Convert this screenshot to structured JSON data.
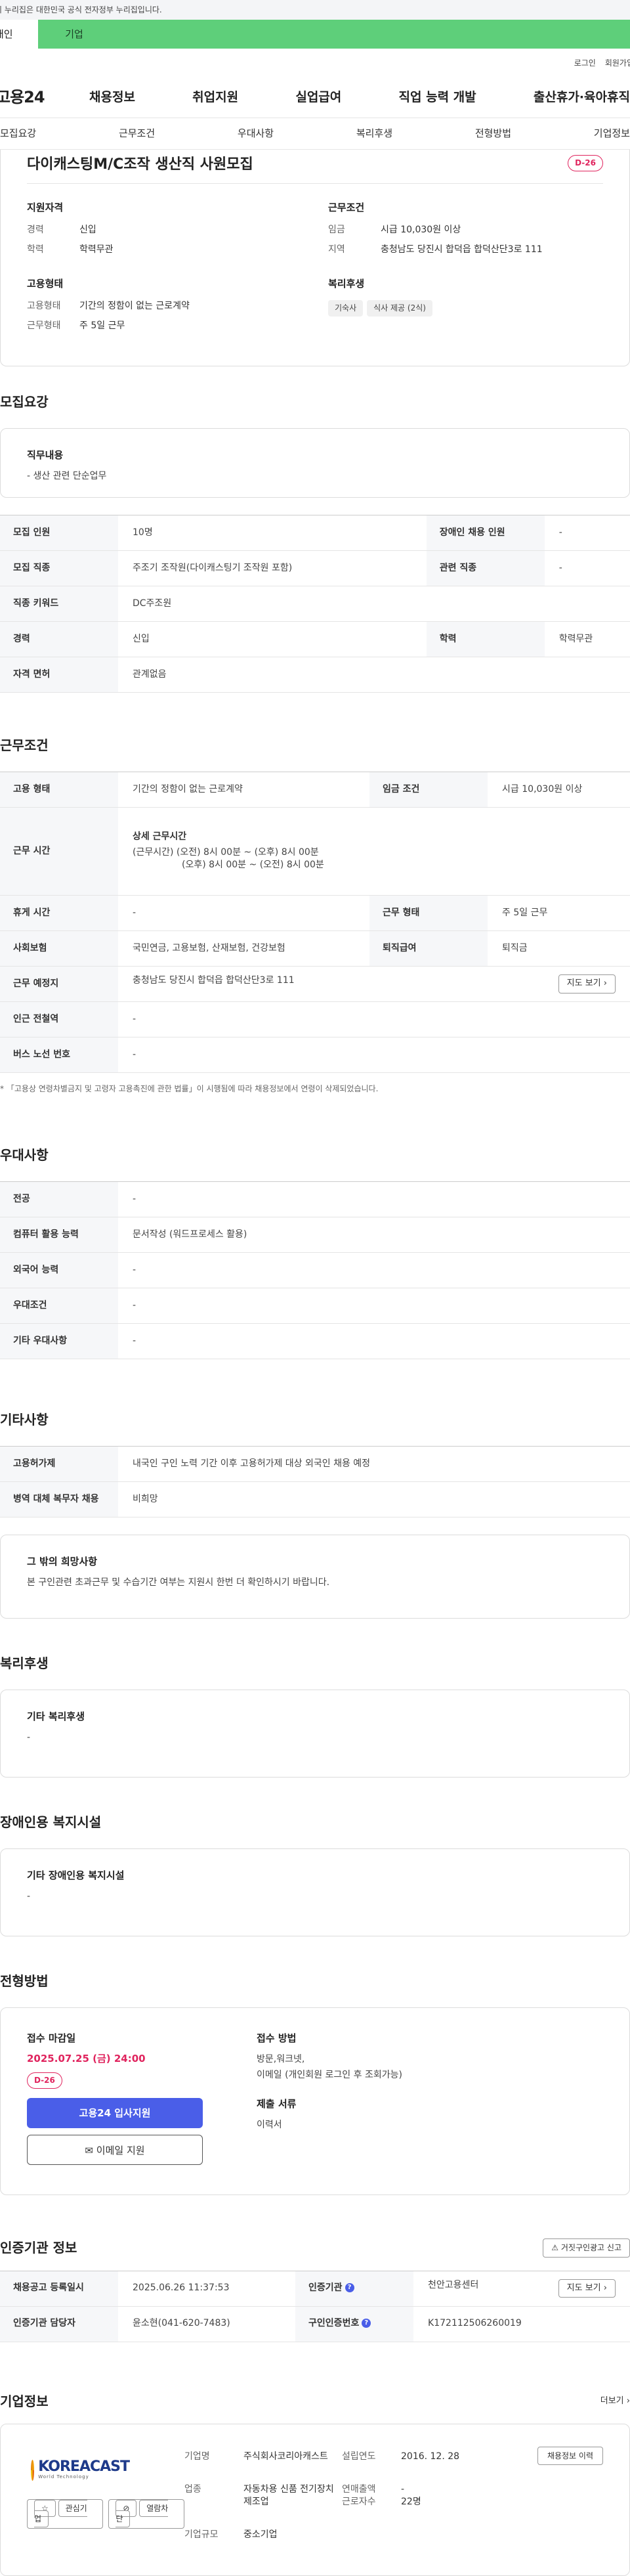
{
  "gov_notice": "이 누리집은 대한민국 공식 전자정부 누리집입니다.",
  "top_tabs": {
    "personal": "개인",
    "company": "기업"
  },
  "util": {
    "login": "로그인",
    "join": "회원가입"
  },
  "gnb": {
    "logo": "고용24",
    "menu": [
      "채용정보",
      "취업지원",
      "실업급여",
      "직업 능력 개발",
      "출산휴가·육아휴직"
    ]
  },
  "lnb": [
    "모집요강",
    "근무조건",
    "우대사항",
    "복리후생",
    "전형방법",
    "기업정보"
  ],
  "summary": {
    "title": "다이캐스팅M/C조작 생산직 사원모집",
    "dday": "D-26",
    "qualification": {
      "heading": "지원자격",
      "career_k": "경력",
      "career_v": "신입",
      "edu_k": "학력",
      "edu_v": "학력무관"
    },
    "conditions": {
      "heading": "근무조건",
      "wage_k": "임금",
      "wage_v": "시급 10,030원 이상",
      "region_k": "지역",
      "region_v": "충청남도 당진시 합덕읍 합덕산단3로 111"
    },
    "employment": {
      "heading": "고용형태",
      "type_k": "고용형태",
      "type_v": "기간의 정함이 없는 근로계약",
      "days_k": "근무형태",
      "days_v": "주 5일 근무"
    },
    "welfare": {
      "heading": "복리후생",
      "chips": [
        "기숙사",
        "식사 제공 (2식)"
      ]
    }
  },
  "recruit": {
    "section_title": "모집요강",
    "duty_heading": "직무내용",
    "duty_text": "-  생산 관련 단순업무",
    "rows": [
      {
        "k1": "모집 인원",
        "v1": "10명",
        "k2": "장애인 채용 인원",
        "v2": "-"
      },
      {
        "k1": "모집 직종",
        "v1": "주조기 조작원(다이캐스팅기 조작원 포함)",
        "k2": "관련 직종",
        "v2": "-"
      },
      {
        "k1": "직종 키워드",
        "v1": "DC주조원"
      },
      {
        "k1": "경력",
        "v1": "신입",
        "k2": "학력",
        "v2": "학력무관"
      },
      {
        "k1": "자격 면허",
        "v1": "관계없음"
      }
    ]
  },
  "work": {
    "section_title": "근무조건",
    "type_k": "고용 형태",
    "type_v": "기간의 정함이 없는 근로계약",
    "wage_k": "임금 조건",
    "wage_v": "시급 10,030원 이상",
    "hours_k": "근무 시간",
    "hours_head": "상세 근무시간",
    "hours_line1": "(근무시간) (오전) 8시 00분 ~ (오후) 8시 00분",
    "hours_line2": "(오후) 8시 00분 ~ (오전) 8시 00분",
    "break_k": "휴게 시간",
    "break_v": "-",
    "form_k": "근무 형태",
    "form_v": "주 5일 근무",
    "ins_k": "사회보험",
    "ins_v": "국민연금, 고용보험, 산재보험, 건강보험",
    "sev_k": "퇴직급여",
    "sev_v": "퇴직금",
    "place_k": "근무 예정지",
    "place_v": "충청남도 당진시 합덕읍 합덕산단3로 111",
    "map_btn": "지도 보기",
    "subway_k": "인근 전철역",
    "subway_v": "-",
    "bus_k": "버스 노선 번호",
    "bus_v": "-",
    "note": "* 「고용상 연령차별금지 및 고령자 고용촉진에 관한 법률」이 시행됨에 따라 채용정보에서 연령이 삭제되었습니다."
  },
  "prefer": {
    "section_title": "우대사항",
    "rows": [
      {
        "k": "전공",
        "v": "-"
      },
      {
        "k": "컴퓨터 활용 능력",
        "v": "문서작성 (워드프로세스 활용)"
      },
      {
        "k": "외국어 능력",
        "v": "-"
      },
      {
        "k": "우대조건",
        "v": "-"
      },
      {
        "k": "기타 우대사항",
        "v": "-"
      }
    ]
  },
  "etc": {
    "section_title": "기타사항",
    "rows": [
      {
        "k": "고용허가제",
        "v": "내국인 구인 노력 기간 이후 고용허가제 대상 외국인 채용 예정"
      },
      {
        "k": "병역 대체 복무자 채용",
        "v": "비희망"
      }
    ],
    "box_heading": "그 밖의 희망사항",
    "box_text": "본 구인관련 초과근무 및 수습기간 여부는 지원시 한번 더 확인하시기 바랍니다."
  },
  "welfare": {
    "section_title": "복리후생",
    "heading": "기타 복리후생",
    "text": "-"
  },
  "disabled": {
    "section_title": "장애인용 복지시설",
    "heading": "기타 장애인용 복지시설",
    "text": "-"
  },
  "apply": {
    "section_title": "전형방법",
    "deadline_label": "접수 마감일",
    "deadline": "2025.07.25 (금) 24:00",
    "dday": "D-26",
    "apply_btn": "고용24 입사지원",
    "email_btn": "이메일 지원",
    "method_label": "접수 방법",
    "method_1": "방문,워크넷,",
    "method_2": "이메일 (개인회원 로그인 후 조회가능)",
    "docs_label": "제출 서류",
    "docs": "이력서"
  },
  "cert": {
    "section_title": "인증기관 정보",
    "report_btn": "거짓구인광고 신고",
    "reg_k": "채용공고 등록일시",
    "reg_v": "2025.06.26 11:37:53",
    "org_k": "인증기관",
    "org_v": "천안고용센터",
    "map_btn": "지도 보기",
    "mgr_k": "인증기관 담당자",
    "mgr_v": "윤소현(041-620-7483)",
    "no_k": "구인인증번호",
    "no_v": "K172112506260019"
  },
  "company": {
    "section_title": "기업정보",
    "more": "더보기",
    "logo_text": "KOREACAST",
    "logo_sub": "World Technology",
    "fav_btn": "관심기업",
    "block_btn": "열람차단",
    "name_k": "기업명",
    "name_v": "주식회사코리아캐스트",
    "est_k": "설립연도",
    "est_v": "2016. 12. 28",
    "sales_k": "연매출액",
    "sales_v": "-",
    "ind_k": "업종",
    "ind_v": "자동차용 신품 전기장치 제조업",
    "emp_k": "근로자수",
    "emp_v": "22명",
    "size_k": "기업규모",
    "size_v": "중소기업",
    "history_btn": "채용정보 이력"
  }
}
